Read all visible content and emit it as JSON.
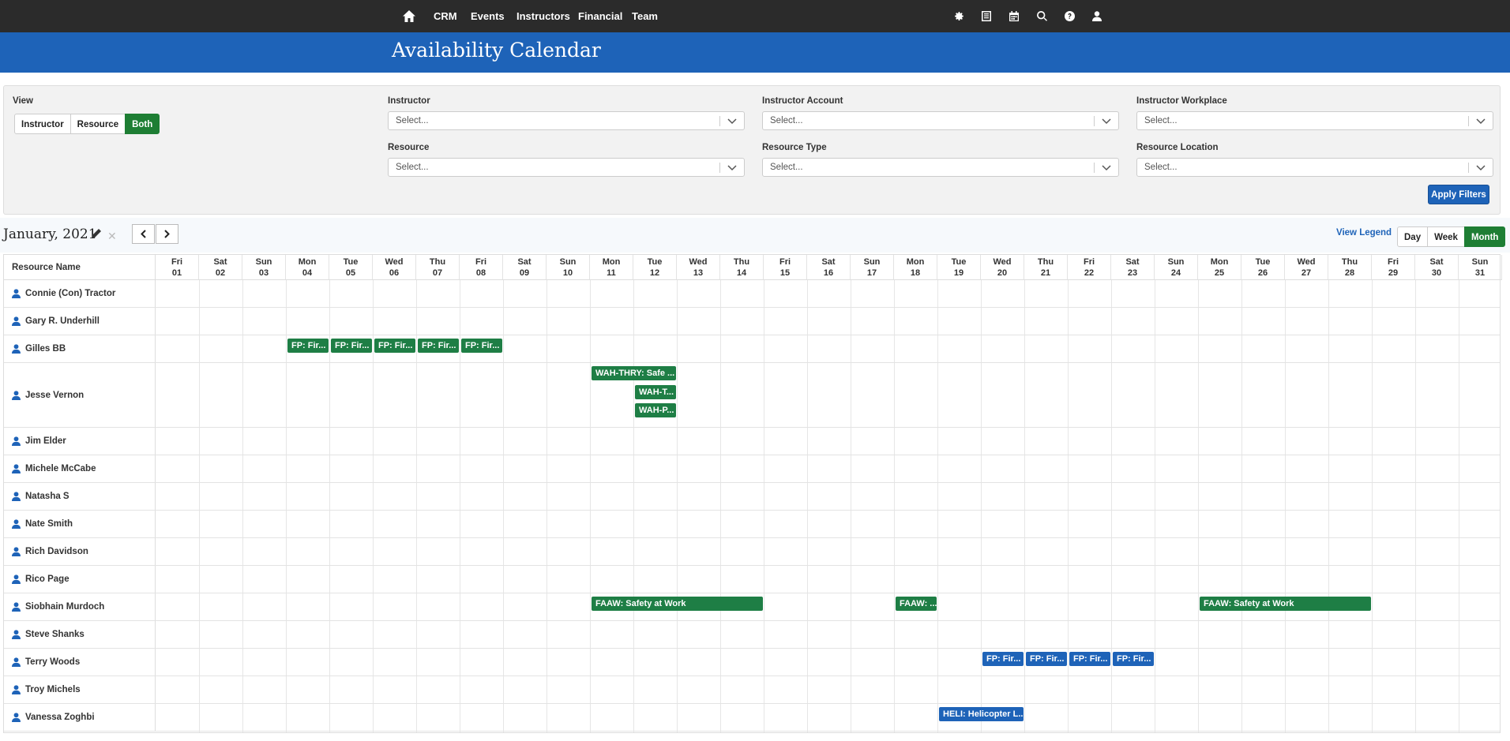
{
  "nav": {
    "items": [
      "CRM",
      "Events",
      "Instructors",
      "Financial",
      "Team"
    ],
    "icons": [
      "gear-icon",
      "list-icon",
      "calendar-icon",
      "search-icon",
      "help-icon",
      "user-icon"
    ]
  },
  "page_title": "Availability Calendar",
  "filters": {
    "view_label": "View",
    "view_options": [
      "Instructor",
      "Resource",
      "Both"
    ],
    "view_selected": "Both",
    "instructor": {
      "label": "Instructor",
      "placeholder": "Select..."
    },
    "instructor_account": {
      "label": "Instructor Account",
      "placeholder": "Select..."
    },
    "instructor_workplace": {
      "label": "Instructor Workplace",
      "placeholder": "Select..."
    },
    "resource": {
      "label": "Resource",
      "placeholder": "Select..."
    },
    "resource_type": {
      "label": "Resource Type",
      "placeholder": "Select..."
    },
    "resource_location": {
      "label": "Resource Location",
      "placeholder": "Select..."
    },
    "apply_label": "Apply Filters"
  },
  "calendar": {
    "month_title": "January, 2021",
    "view_legend": "View Legend",
    "range_options": [
      "Day",
      "Week",
      "Month"
    ],
    "range_selected": "Month",
    "name_header": "Resource Name",
    "days": [
      [
        "Fri",
        "01"
      ],
      [
        "Sat",
        "02"
      ],
      [
        "Sun",
        "03"
      ],
      [
        "Mon",
        "04"
      ],
      [
        "Tue",
        "05"
      ],
      [
        "Wed",
        "06"
      ],
      [
        "Thu",
        "07"
      ],
      [
        "Fri",
        "08"
      ],
      [
        "Sat",
        "09"
      ],
      [
        "Sun",
        "10"
      ],
      [
        "Mon",
        "11"
      ],
      [
        "Tue",
        "12"
      ],
      [
        "Wed",
        "13"
      ],
      [
        "Thu",
        "14"
      ],
      [
        "Fri",
        "15"
      ],
      [
        "Sat",
        "16"
      ],
      [
        "Sun",
        "17"
      ],
      [
        "Mon",
        "18"
      ],
      [
        "Tue",
        "19"
      ],
      [
        "Wed",
        "20"
      ],
      [
        "Thu",
        "21"
      ],
      [
        "Fri",
        "22"
      ],
      [
        "Sat",
        "23"
      ],
      [
        "Sun",
        "24"
      ],
      [
        "Mon",
        "25"
      ],
      [
        "Tue",
        "26"
      ],
      [
        "Wed",
        "27"
      ],
      [
        "Thu",
        "28"
      ],
      [
        "Fri",
        "29"
      ],
      [
        "Sat",
        "30"
      ],
      [
        "Sun",
        "31"
      ]
    ],
    "rows": [
      {
        "name": "Connie (Con) Tractor",
        "lines": 1,
        "events": []
      },
      {
        "name": "Gary R. Underhill",
        "lines": 1,
        "events": []
      },
      {
        "name": "Gilles BB",
        "lines": 1,
        "events": [
          {
            "label": "FP: Fir...",
            "start": 4,
            "end": 4,
            "lane": 0,
            "color": "#1e7e45"
          },
          {
            "label": "FP: Fir...",
            "start": 5,
            "end": 5,
            "lane": 0,
            "color": "#1e7e45"
          },
          {
            "label": "FP: Fir...",
            "start": 6,
            "end": 6,
            "lane": 0,
            "color": "#1e7e45"
          },
          {
            "label": "FP: Fir...",
            "start": 7,
            "end": 7,
            "lane": 0,
            "color": "#1e7e45"
          },
          {
            "label": "FP: Fir...",
            "start": 8,
            "end": 8,
            "lane": 0,
            "color": "#1e7e45"
          }
        ]
      },
      {
        "name": "Jesse Vernon",
        "lines": 3,
        "events": [
          {
            "label": "WAH-THRY: Safe ...",
            "start": 11,
            "end": 12,
            "lane": 0,
            "color": "#1e7e45"
          },
          {
            "label": "WAH-T...",
            "start": 12,
            "end": 12,
            "lane": 1,
            "color": "#1e7e45"
          },
          {
            "label": "WAH-P...",
            "start": 12,
            "end": 12,
            "lane": 2,
            "color": "#1e7e45"
          }
        ]
      },
      {
        "name": "Jim Elder",
        "lines": 1,
        "events": []
      },
      {
        "name": "Michele McCabe",
        "lines": 1,
        "events": []
      },
      {
        "name": "Natasha S",
        "lines": 1,
        "events": []
      },
      {
        "name": "Nate Smith",
        "lines": 1,
        "events": []
      },
      {
        "name": "Rich Davidson",
        "lines": 1,
        "events": []
      },
      {
        "name": "Rico Page",
        "lines": 1,
        "events": []
      },
      {
        "name": "Siobhain Murdoch",
        "lines": 1,
        "events": [
          {
            "label": "FAAW: Safety at Work",
            "start": 11,
            "end": 14,
            "lane": 0,
            "color": "#1e7e45"
          },
          {
            "label": "FAAW: ...",
            "start": 18,
            "end": 18,
            "lane": 0,
            "color": "#1e7e45"
          },
          {
            "label": "FAAW: Safety at Work",
            "start": 25,
            "end": 28,
            "lane": 0,
            "color": "#1e7e45"
          }
        ]
      },
      {
        "name": "Steve Shanks",
        "lines": 1,
        "events": []
      },
      {
        "name": "Terry Woods",
        "lines": 1,
        "events": [
          {
            "label": "FP: Fir...",
            "start": 20,
            "end": 20,
            "lane": 0,
            "color": "#1e63b8"
          },
          {
            "label": "FP: Fir...",
            "start": 21,
            "end": 21,
            "lane": 0,
            "color": "#1e63b8"
          },
          {
            "label": "FP: Fir...",
            "start": 22,
            "end": 22,
            "lane": 0,
            "color": "#1e63b8"
          },
          {
            "label": "FP: Fir...",
            "start": 23,
            "end": 23,
            "lane": 0,
            "color": "#1e63b8"
          }
        ]
      },
      {
        "name": "Troy Michels",
        "lines": 1,
        "events": []
      },
      {
        "name": "Vanessa Zoghbi",
        "lines": 1,
        "events": [
          {
            "label": "HELI: Helicopter L...",
            "start": 19,
            "end": 20,
            "lane": 0,
            "color": "#1e63b8"
          }
        ]
      }
    ]
  }
}
